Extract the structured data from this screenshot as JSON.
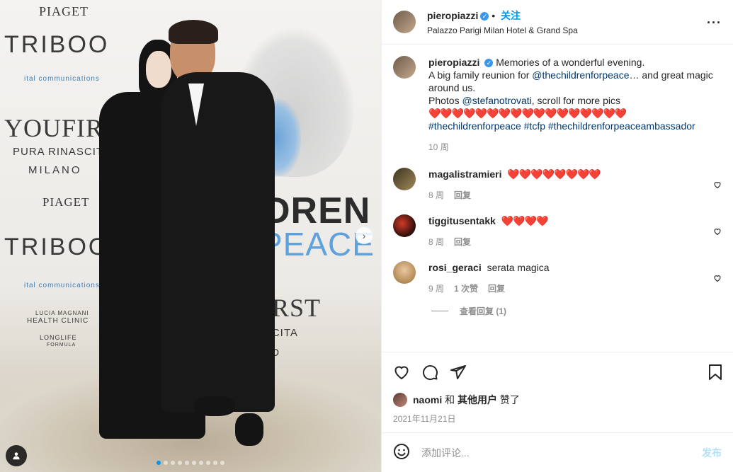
{
  "post": {
    "username": "pieropiazzi",
    "follow_label": "关注",
    "location": "Palazzo Parigi Milan Hotel & Grand Spa"
  },
  "backdrop": {
    "piaget": "PIAGET",
    "triboo": "TRIBOO",
    "ital": "ital communications",
    "youfirst": "YOUFIRST",
    "pura": "PURA RINASCITA",
    "milano": "MILANO",
    "lucia": "LUCIA MAGNANI",
    "health": "HEALTH CLINIC",
    "longlife": "LONGLIFE",
    "formula": "FORMULA",
    "dren": "DREN",
    "peace": "PEACE",
    "first": "FIRST",
    "nascita": "NASCITA",
    "mano": "MANO"
  },
  "caption": {
    "username": "pieropiazzi",
    "line1": "Memories of a wonderful evening.",
    "line2_pre": "A big family reunion for ",
    "line2_mention": "@thechildrenforpeace",
    "line2_post": "… and great magic around us.",
    "line3_pre": "Photos ",
    "line3_mention": "@stefanotrovati",
    "line3_post": ", scroll for more pics",
    "hearts": "❤️❤️❤️❤️❤️❤️❤️❤️❤️❤️❤️❤️❤️❤️❤️❤️❤️",
    "tags": "#thechildrenforpeace #tcfp #thechildrenforpeaceambassador",
    "time": "10 周"
  },
  "comments": [
    {
      "username": "magalistramieri",
      "text": "❤️❤️❤️❤️❤️❤️❤️❤️",
      "time": "8 周",
      "likes": "",
      "reply": "回复"
    },
    {
      "username": "tiggitusentakk",
      "text": "❤️❤️❤️❤️",
      "time": "8 周",
      "likes": "",
      "reply": "回复"
    },
    {
      "username": "rosi_geraci",
      "text": "serata magica",
      "time": "9 周",
      "likes": "1 次赞",
      "reply": "回复"
    }
  ],
  "view_replies": "查看回复 (1)",
  "likes": {
    "user": "naomi",
    "and": "和",
    "others": "其他用户",
    "liked": "赞了"
  },
  "date": "2021年11月21日",
  "add_comment": {
    "placeholder": "添加评论...",
    "post_label": "发布"
  },
  "colors": {
    "link": "#00376b",
    "follow": "#0095f6",
    "verified": "#3897f0",
    "secondary": "#8e8e8e"
  }
}
